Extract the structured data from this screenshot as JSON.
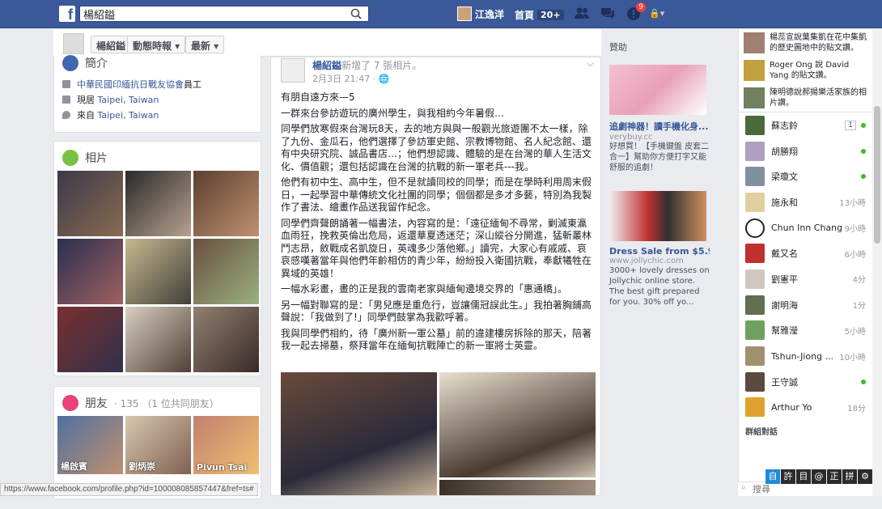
{
  "topbar": {
    "logo": "f",
    "search_value": "楊紹鎰",
    "user_name": "江逸洋",
    "home_label": "首頁",
    "home_count": "20+",
    "notif_count": "9"
  },
  "subbar": {
    "name_btn": "楊紹鎰",
    "timeline_btn": "動態時報 ▾",
    "recent_btn": "最新 ▾"
  },
  "intro": {
    "title": "簡介",
    "org": "中華民國印緬抗日戰友協會",
    "org_suffix": "員工",
    "lives_prefix": "現居",
    "lives_city": "Taipei, Taiwan",
    "from_prefix": "來自",
    "from_city": "Taipei, Taiwan"
  },
  "photos": {
    "title": "相片"
  },
  "friends": {
    "title": "朋友",
    "count": "· 135 （1 位共同朋友）",
    "items": [
      "楊啟賓",
      "劉炳崇",
      "Pivun Tsai"
    ]
  },
  "post": {
    "author": "楊紹鎰",
    "action": "新增了 7 張相片。",
    "time": "2月3日 21:47 · ",
    "paragraphs": [
      "有朋自遠方來—5",
      "一群來台參訪遊玩的廣州學生，與我相約今年暑假…",
      "同學們放寒假來台灣玩8天，去的地方與與一般觀光旅遊團不太一樣，除了九份、金瓜石，他們選擇了參訪軍史館、宗教博物館、名人紀念館、還有中央研究院、誠品書店…；他們想認識、體驗的是在台灣的華人生活文化、價值觀；還包括認識在台灣的抗戰的新一軍老兵---我。",
      "他們有初中生、高中生，但不是就讀同校的同學；而是在學時利用周末假日，一起學習中華傳統文化社團的同學；個個都是多才多藝，特別為我製作了書法、繪畫作品送我留作紀念。",
      "同學們齊聲朗誦著一幅書法，內容寫的是：「遠征緬甸不尋常，剿滅東瀛血雨狂，挽救英倫出危局，返還華夏透迷茫；深山縱谷分開進，猛斬叢林鬥志昂，斂戰成名凱旋日，英魂多少落他鄉。」讀完，大家心有戚戚、哀哀感嘆著當年與他們年齡相仿的青少年，紛紛投入衛國抗戰，奉獻犧牲在異域的英雄！",
      "一幅水彩畫，畫的正是我的雲南老家與緬甸邊境交界的「惠通橋」。",
      "另一幅對聯寫的是：「男兒應是重危行，豈讓儒冠誤此生。」我拍著胸鋪高聲說：「我做到了!」同學們鼓掌為我歡呼著。",
      "我與同學們相約，待「廣州新一軍公墓」前的違建樓房拆除的那天，陪著我一起去掃墓，祭拜當年在緬甸抗戰陣亡的新一軍將士英靈。"
    ]
  },
  "ads": {
    "title": "贊助",
    "items": [
      {
        "headline": "追劇神器！讀手機化身...",
        "url": "verybuy.cc",
        "body": "好想買！【手機鍵盤 皮套二合一】幫助你方便打字又能舒服的追劇！"
      },
      {
        "headline": "Dress Sale from $5.99!",
        "url": "www.jollychic.com",
        "body": "3000+ lovely dresses on Jollychic online store. The best gift prepared for you. 30% off yo..."
      }
    ]
  },
  "ticker": [
    {
      "text": "楊蕊宣說葉集凱在花中集凱的歷史圖地中的貼文讚。"
    },
    {
      "text": "Roger Ong 說 David Yang 的貼文讚。"
    },
    {
      "text": "陳明德說郝揚樂活家族的相片讚。"
    }
  ],
  "chat": {
    "contacts": [
      {
        "name": "蘇志鈴",
        "meta": "1",
        "online": true
      },
      {
        "name": "胡勝翔",
        "meta": "",
        "online": true
      },
      {
        "name": "梁瓊文",
        "meta": "",
        "online": true
      },
      {
        "name": "施永和",
        "meta": "13小時",
        "online": false
      },
      {
        "name": "Chun Inn Chang",
        "meta": "9小時",
        "online": false
      },
      {
        "name": "戴又名",
        "meta": "6小時",
        "online": false
      },
      {
        "name": "劉憲平",
        "meta": "4分",
        "online": false
      },
      {
        "name": "謝明海",
        "meta": "1分",
        "online": false
      },
      {
        "name": "幫雅瀅",
        "meta": "5小時",
        "online": false
      },
      {
        "name": "Tshun-Jiong ...",
        "meta": "10小時",
        "online": false
      },
      {
        "name": "王守誠",
        "meta": "",
        "online": true
      },
      {
        "name": "Arthur Yo",
        "meta": "18分",
        "online": false
      }
    ],
    "group_title": "群組對話",
    "search_placeholder": "搜尋"
  },
  "ime": [
    "自",
    "許",
    "目",
    "@",
    "正",
    "拼",
    "⚙"
  ],
  "status_url": "https://www.facebook.com/profile.php?id=100008085857447&fref=ts#"
}
